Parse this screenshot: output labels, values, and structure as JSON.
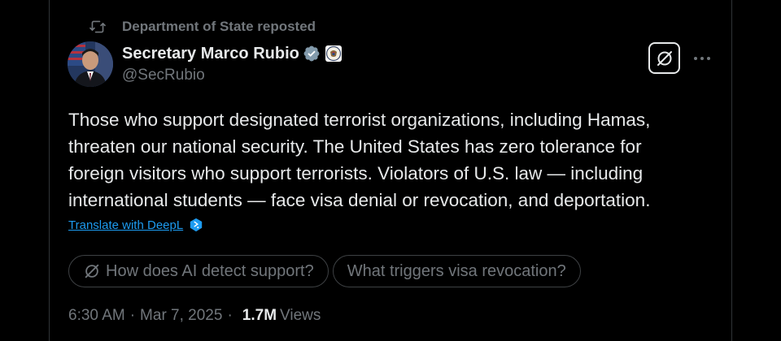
{
  "repost": {
    "text": "Department of State reposted",
    "icon": "repost-icon"
  },
  "author": {
    "display_name": "Secretary Marco Rubio",
    "handle": "@SecRubio",
    "verified_color": "#829aab",
    "affiliate_badge": "department-of-state-seal"
  },
  "actions": {
    "grok_icon": "grok-icon",
    "more_icon": "more-dots-icon"
  },
  "tweet": {
    "lines": [
      "Those who support designated terrorist organizations, including Hamas,",
      "threaten our national security. The United States has zero tolerance for",
      "foreign visitors who support terrorists. Violators of U.S. law — including",
      "international students — face visa denial or revocation, and deportation."
    ]
  },
  "translate": {
    "label": "Translate with DeepL",
    "icon": "deepl-icon"
  },
  "chips": [
    {
      "label": "How does AI detect support?",
      "icon": "grok-icon"
    },
    {
      "label": "What triggers visa revocation?"
    }
  ],
  "meta": {
    "time": "6:30 AM",
    "separator": "·",
    "date": "Mar 7, 2025",
    "views_count": "1.7M",
    "views_label": "Views"
  },
  "colors": {
    "background": "#000000",
    "text": "#e7e9ea",
    "muted": "#71767b",
    "link": "#1d9bf0",
    "border": "#2f3336"
  }
}
